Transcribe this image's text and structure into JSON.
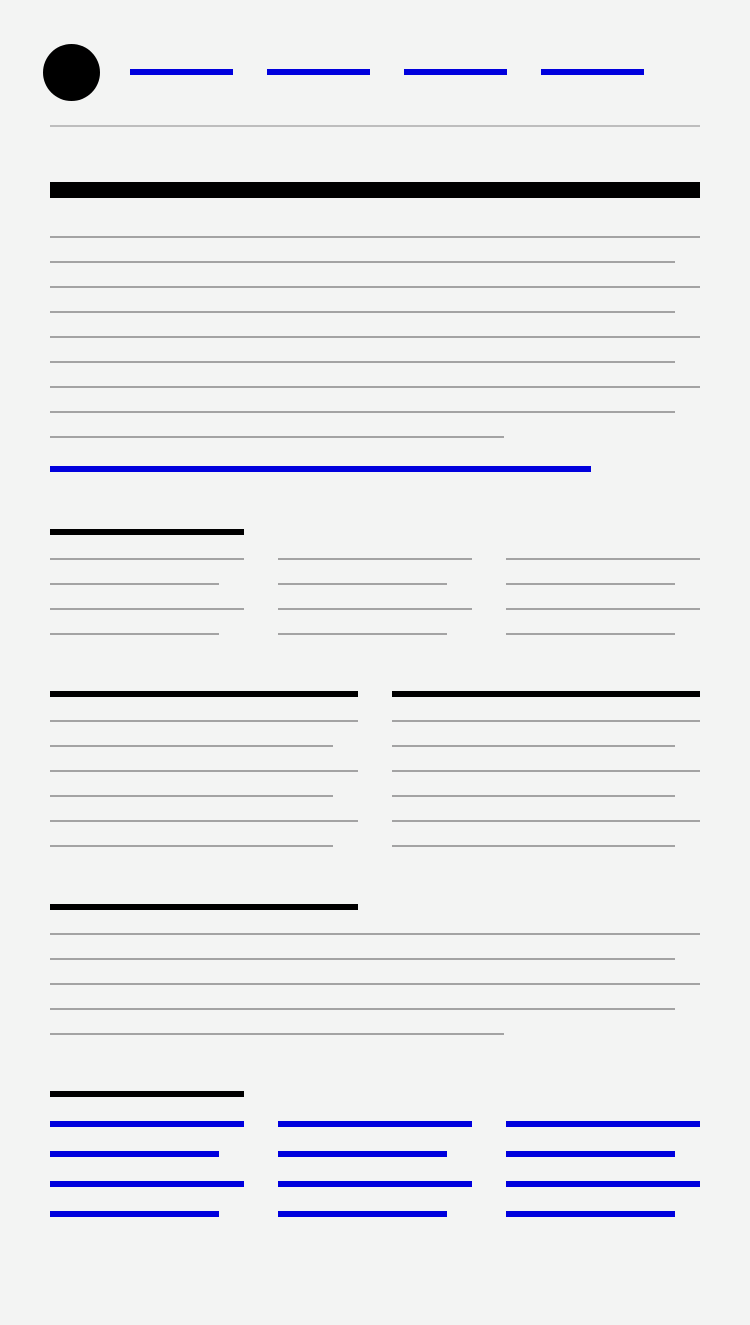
{
  "theme": {
    "background": "#f3f4f3",
    "heading": "#000000",
    "text_line": "#a3a3a3",
    "divider": "#bdbdbd",
    "link": "#0000dd"
  },
  "header": {
    "logo_icon": "circle-logo",
    "nav_links": 4
  },
  "main": {
    "paragraph_lines": 9,
    "columns_section_3": {
      "columns": 3,
      "lines_per_column": 4
    },
    "columns_section_2": {
      "columns": 2,
      "lines_per_column": 6
    },
    "text_section": {
      "lines": 5
    },
    "link_grid": {
      "columns": 3,
      "links_per_column": 4
    }
  }
}
